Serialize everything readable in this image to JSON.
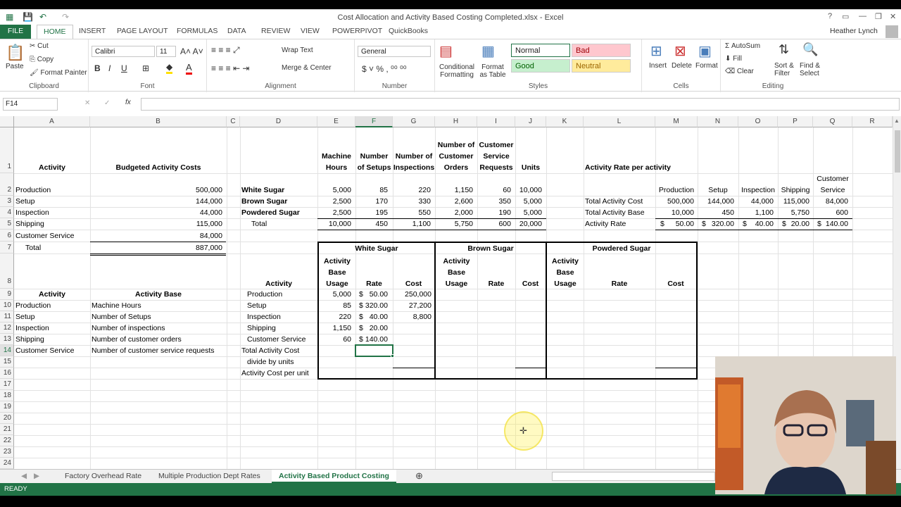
{
  "window": {
    "title": "Cost Allocation and Activity Based Costing Completed.xlsx - Excel",
    "user": "Heather Lynch"
  },
  "ribbon_tabs": [
    "FILE",
    "HOME",
    "INSERT",
    "PAGE LAYOUT",
    "FORMULAS",
    "DATA",
    "REVIEW",
    "VIEW",
    "POWERPIVOT",
    "QuickBooks"
  ],
  "ribbon": {
    "clipboard": {
      "paste": "Paste",
      "cut": "Cut",
      "copy": "Copy",
      "format_painter": "Format Painter",
      "label": "Clipboard"
    },
    "font": {
      "name": "Calibri",
      "size": "11",
      "label": "Font"
    },
    "alignment": {
      "wrap": "Wrap Text",
      "merge": "Merge & Center",
      "label": "Alignment"
    },
    "number": {
      "format": "General",
      "label": "Number"
    },
    "styles": {
      "conditional": "Conditional Formatting",
      "format_table": "Format as Table",
      "normal": "Normal",
      "bad": "Bad",
      "good": "Good",
      "neutral": "Neutral",
      "label": "Styles"
    },
    "cells": {
      "insert": "Insert",
      "delete": "Delete",
      "format": "Format",
      "label": "Cells"
    },
    "editing": {
      "autosum": "AutoSum",
      "fill": "Fill",
      "clear": "Clear",
      "sort": "Sort & Filter",
      "find": "Find & Select",
      "label": "Editing"
    }
  },
  "formula_bar": {
    "name_box": "F14",
    "formula": ""
  },
  "columns": [
    "A",
    "B",
    "C",
    "D",
    "E",
    "F",
    "G",
    "H",
    "I",
    "J",
    "K",
    "L",
    "M",
    "N",
    "O",
    "P",
    "Q",
    "R"
  ],
  "rows": [
    "1",
    "2",
    "3",
    "4",
    "5",
    "6",
    "7",
    "8",
    "9",
    "10",
    "11",
    "12",
    "13",
    "14",
    "15",
    "16",
    "17",
    "18",
    "19",
    "20",
    "21",
    "22",
    "23",
    "24"
  ],
  "cells": {
    "A1": "Activity",
    "B1": "Budgeted Activity Costs",
    "A2": "Production",
    "B2": "500,000",
    "A3": "Setup",
    "B3": "144,000",
    "A4": "Inspection",
    "B4": "44,000",
    "A5": "Shipping",
    "B5": "115,000",
    "A6": "Customer Service",
    "B6": "84,000",
    "A7": "Total",
    "B7": "887,000",
    "A9": "Activity",
    "B9": "Activity Base",
    "A10": "Production",
    "B10": "Machine Hours",
    "A11": "Setup",
    "B11": "Number of Setups",
    "A12": "Inspection",
    "B12": "Number of inspections",
    "A13": "Shipping",
    "B13": "Number of customer orders",
    "A14": "Customer Service",
    "B14": "Number of customer service requests",
    "E1a": "Machine",
    "E1b": "Hours",
    "F1a": "Number",
    "F1b": "of Setups",
    "G1a": "Number of",
    "G1b": "Inspections",
    "H1a": "Number of",
    "H1b": "Customer",
    "H1c": "Orders",
    "I1a": "Customer",
    "I1b": "Service",
    "I1c": "Requests",
    "J1": "Units",
    "D2": "White Sugar",
    "E2": "5,000",
    "F2": "85",
    "G2": "220",
    "H2": "1,150",
    "I2": "60",
    "J2": "10,000",
    "D3": "Brown Sugar",
    "E3": "2,500",
    "F3": "170",
    "G3": "330",
    "H3": "2,600",
    "I3": "350",
    "J3": "5,000",
    "D4": "Powdered Sugar",
    "E4": "2,500",
    "F4": "195",
    "G4": "550",
    "H4": "2,000",
    "I4": "190",
    "J4": "5,000",
    "D5": "Total",
    "E5": "10,000",
    "F5": "450",
    "G5": "1,100",
    "H5": "5,750",
    "I5": "600",
    "J5": "20,000",
    "L1": "Activity Rate per activity",
    "Q1a": "Customer",
    "Q1b": "Service",
    "M2": "Production",
    "N2": "Setup",
    "O2": "Inspection",
    "P2": "Shipping",
    "L3": "Total Activity Cost",
    "M3": "500,000",
    "N3": "144,000",
    "O3": "44,000",
    "P3": "115,000",
    "Q3": "84,000",
    "L4": "Total Activity Base",
    "M4": "10,000",
    "N4": "450",
    "O4": "1,100",
    "P4": "5,750",
    "Q4": "600",
    "L5": "Activity Rate",
    "M5": "50.00",
    "N5": "320.00",
    "O5": "40.00",
    "P5": "20.00",
    "Q5": "140.00",
    "dollar": "$",
    "WS": "White Sugar",
    "BS": "Brown Sugar",
    "PS": "Powdered Sugar",
    "hdr_a": "Activity",
    "hdr_b": "Base",
    "hdr_c": "Usage",
    "hdr_rate": "Rate",
    "hdr_cost": "Cost",
    "D8": "Activity",
    "D9": "Production",
    "E9": "5,000",
    "F9": "50.00",
    "G9": "250,000",
    "D10": "Setup",
    "E10": "85",
    "F10": "320.00",
    "G10": "27,200",
    "D11": "Inspection",
    "E11": "220",
    "F11": "40.00",
    "G11": "8,800",
    "D12": "Shipping",
    "E12": "1,150",
    "F12": "20.00",
    "D13": "Customer Service",
    "E13": "60",
    "F13": "140.00",
    "D14": "Total Activity Cost",
    "D15": "divide by units",
    "D16": "Activity Cost per unit"
  },
  "sheet_tabs": [
    "Factory Overhead Rate",
    "Multiple Production Dept Rates",
    "Activity Based Product Costing"
  ],
  "status": "READY",
  "colors": {
    "excel_green": "#217346",
    "bad_bg": "#ffc7ce",
    "good_bg": "#c6efce",
    "neutral_bg": "#ffeb9c"
  }
}
